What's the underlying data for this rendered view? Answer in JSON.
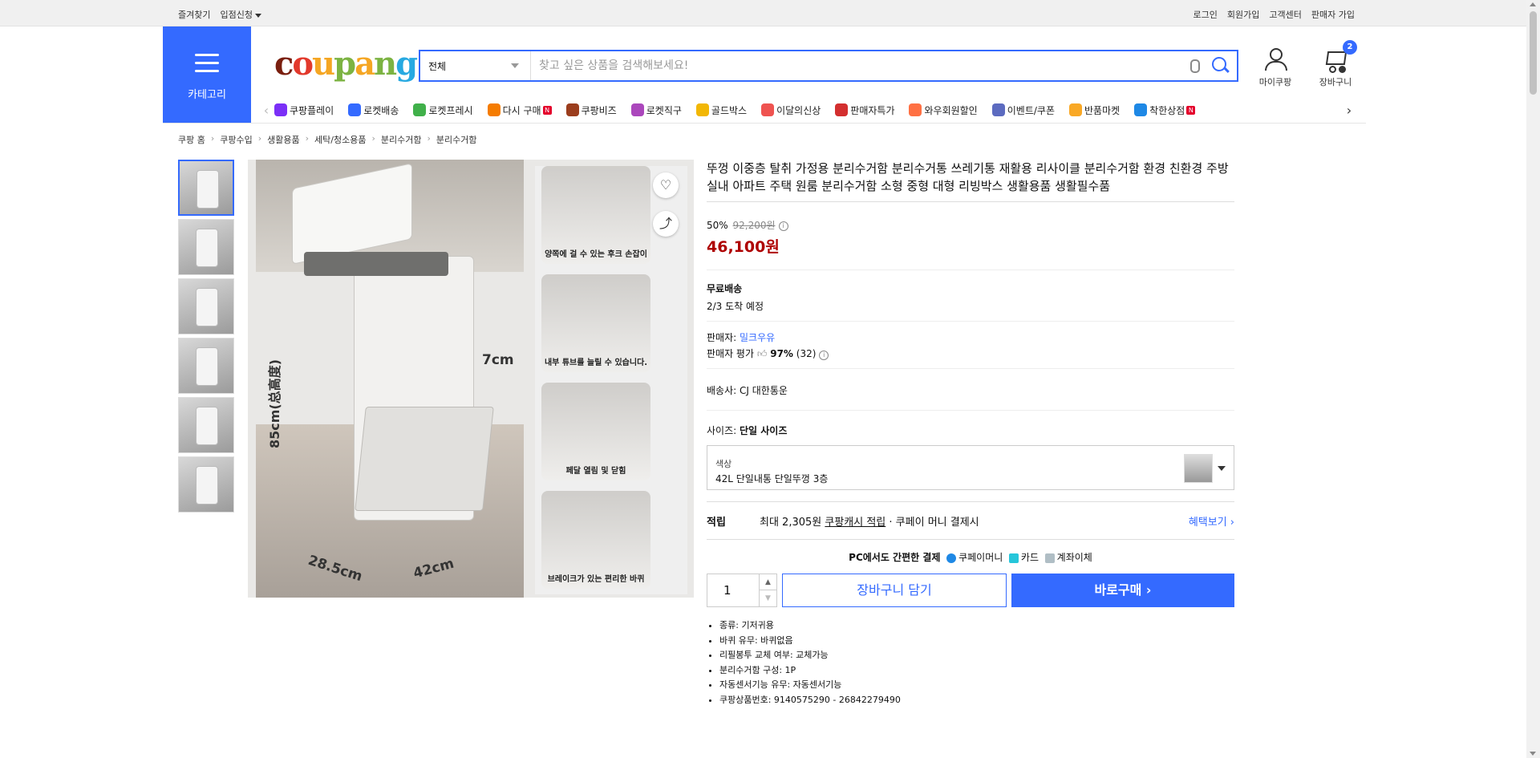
{
  "topbar": {
    "left": [
      "즐겨찾기",
      "입점신청"
    ],
    "right": [
      "로그인",
      "회원가입",
      "고객센터",
      "판매자 가입"
    ]
  },
  "header": {
    "category_label": "카테고리",
    "logo": "coupang",
    "search_category": "전체",
    "search_placeholder": "찾고 싶은 상품을 검색해보세요!",
    "mycoupang": "마이쿠팡",
    "cart": "장바구니",
    "cart_count": "2"
  },
  "gnb": [
    {
      "label": "쿠팡플레이",
      "color": "#7b2ff7",
      "new": false
    },
    {
      "label": "로켓배송",
      "color": "#346aff",
      "new": false
    },
    {
      "label": "로켓프레시",
      "color": "#40b04a",
      "new": false
    },
    {
      "label": "다시 구매",
      "color": "#f57c00",
      "new": true
    },
    {
      "label": "쿠팡비즈",
      "color": "#9b3d1d",
      "new": false
    },
    {
      "label": "로켓직구",
      "color": "#ab47bc",
      "new": false
    },
    {
      "label": "골드박스",
      "color": "#f2b705",
      "new": false
    },
    {
      "label": "이달의신상",
      "color": "#ef5350",
      "new": false
    },
    {
      "label": "판매자특가",
      "color": "#d32f2f",
      "new": false
    },
    {
      "label": "와우회원할인",
      "color": "#ff7043",
      "new": false
    },
    {
      "label": "이벤트/쿠폰",
      "color": "#5c6bc0",
      "new": false
    },
    {
      "label": "반품마켓",
      "color": "#f9a825",
      "new": false
    },
    {
      "label": "착한상점",
      "color": "#1e88e5",
      "new": true
    }
  ],
  "breadcrumb": [
    "쿠팡 홈",
    "쿠팡수입",
    "생활용품",
    "세탁/청소용품",
    "분리수거함",
    "분리수거함"
  ],
  "image": {
    "dims": [
      "85cm(总高度)",
      "7cm",
      "28.5cm",
      "42cm"
    ],
    "panels": [
      "양쪽에 걸 수 있는 후크 손잡이",
      "내부 튜브를 늘릴 수 있습니다.",
      "페달 열림 및 닫힘",
      "브레이크가 있는 편리한 바퀴"
    ]
  },
  "product": {
    "title": "뚜껑 이중층 탈취 가정용 분리수거함 분리수거통 쓰레기통 재활용 리사이클 분리수거함 환경 친환경 주방 실내 아파트 주택 원룸 분리수거함 소형 중형 대형 리빙박스 생활용품 생활필수품",
    "discount": "50%",
    "original_price": "92,200원",
    "price": "46,100원",
    "shipping_title": "무료배송",
    "arrival": "2/3 도착 예정",
    "seller_label": "판매자:",
    "seller": "밀크우유",
    "seller_rating_label": "판매자 평가",
    "seller_rating": "97%",
    "seller_rating_count": "(32)",
    "carrier_label": "배송사:",
    "carrier": "CJ 대한통운",
    "size_label": "사이즈:",
    "size": "단일 사이즈",
    "option_label": "색상",
    "option_value": "42L 단일내통 단일뚜껑 3층",
    "reward_label": "적립",
    "reward_text1": "최대 2,305원",
    "reward_link": "쿠팡캐시 적립",
    "reward_text2": "· 쿠페이 머니 결제시",
    "reward_more": "혜택보기 ›",
    "pay_title": "PC에서도 간편한 결제",
    "pay_methods": [
      "쿠페이머니",
      "카드",
      "계좌이체"
    ],
    "quantity": "1",
    "add_cart": "장바구니 담기",
    "buy_now": "바로구매 ›",
    "attributes": [
      "종류: 기저귀용",
      "바퀴 유무: 바퀴없음",
      "리필봉투 교체 여부: 교체가능",
      "분리수거함 구성: 1P",
      "자동센서기능 유무: 자동센서기능",
      "쿠팡상품번호: 9140575290 - 26842279490"
    ]
  }
}
